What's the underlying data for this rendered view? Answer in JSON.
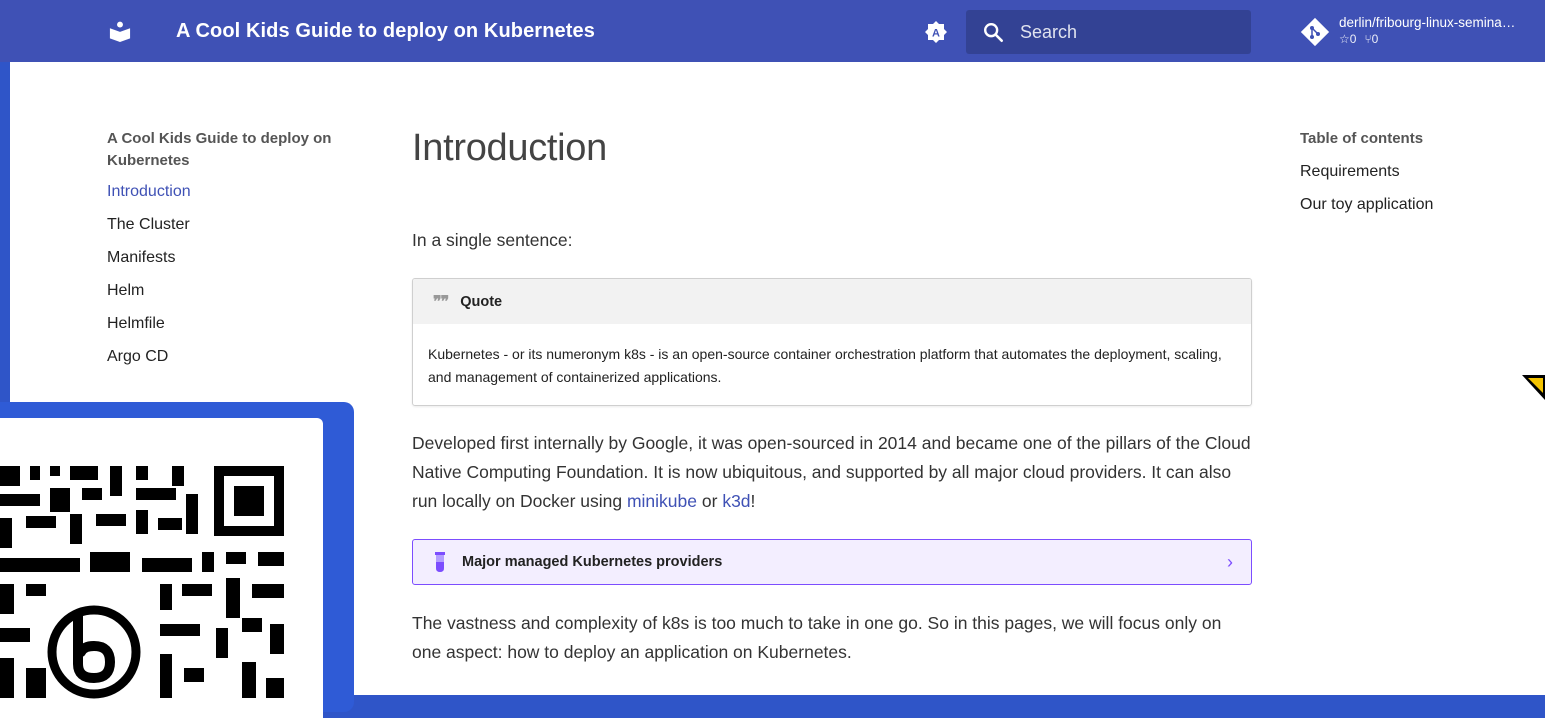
{
  "header": {
    "title": "A Cool Kids Guide to deploy on Kubernetes",
    "search_placeholder": "Search",
    "repo": {
      "name": "derlin/fribourg-linux-semina…",
      "stars": "0",
      "forks": "0"
    }
  },
  "sidebar": {
    "title": "A Cool Kids Guide to deploy on Kubernetes",
    "items": [
      {
        "label": "Introduction",
        "active": true
      },
      {
        "label": "The Cluster"
      },
      {
        "label": "Manifests"
      },
      {
        "label": "Helm"
      },
      {
        "label": "Helmfile"
      },
      {
        "label": "Argo CD"
      }
    ]
  },
  "content": {
    "heading": "Introduction",
    "intro": "In a single sentence:",
    "quote": {
      "title": "Quote",
      "text": "Kubernetes - or its numeronym k8s - is an open-source container orchestration platform that automates the deployment, scaling, and management of containerized applications."
    },
    "para2": {
      "before": "Developed first internally by Google, it was open-sourced in 2014 and became one of the pillars of the Cloud Native Computing Foundation. It is now ubiquitous, and supported by all major cloud providers. It can also run locally on Docker using ",
      "link1": "minikube",
      "middle": " or ",
      "link2": "k3d",
      "after": "!"
    },
    "details_label": "Major managed Kubernetes providers",
    "para3": "The vastness and complexity of k8s is too much to take in one go. So in this pages, we will focus only on one aspect: how to deploy an application on Kubernetes."
  },
  "toc": {
    "title": "Table of contents",
    "items": [
      "Requirements",
      "Our toy application"
    ]
  },
  "colors": {
    "header": "#3f51b5",
    "accent": "#3f51b5",
    "details_border": "#7c4dff",
    "qr_frame": "#2f5bd6",
    "background": "#2f55c8"
  },
  "icons": {
    "logo": "book-reader-icon",
    "palette": "brightness-auto-icon",
    "search": "search-icon",
    "repo": "git-icon",
    "quote": "quote-icon",
    "details": "flask-icon",
    "chevron": "chevron-right-icon"
  }
}
